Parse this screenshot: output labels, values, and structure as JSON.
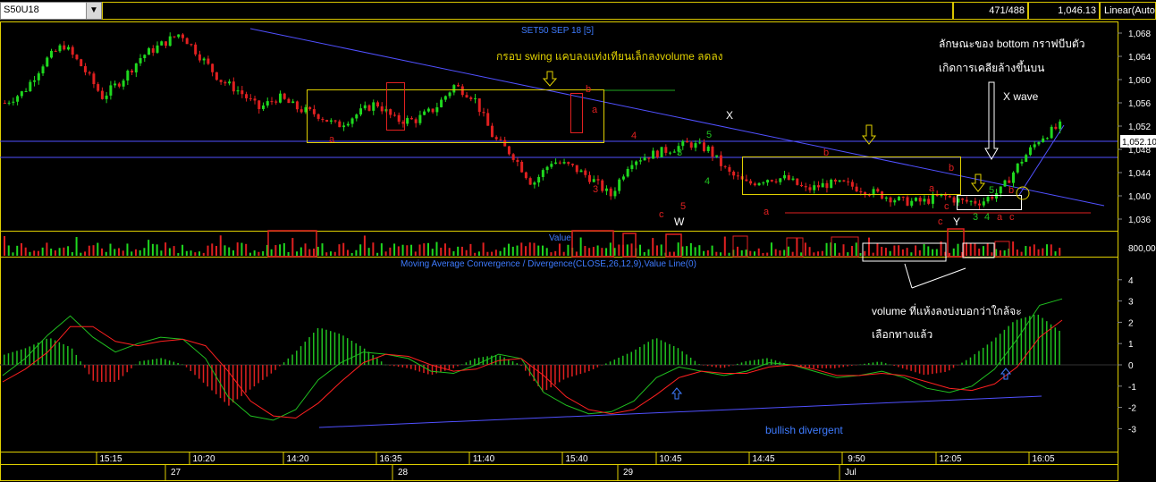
{
  "symbol": "S50U18",
  "bar_count": "471/488",
  "last_price": "1,046.13",
  "scale_mode": "Linear(Auto",
  "colors": {
    "up": "#1fd81f",
    "down": "#e02020",
    "frame": "#e0d000",
    "trend": "#5050ff",
    "signal": "#ff2020",
    "macd": "#20c020",
    "note": "#d8c800",
    "blue_label": "#3e7bff",
    "boxes": "#e0d000"
  },
  "price_panel": {
    "title": "SET50 SEP 18   [5]",
    "current_price_tag": "1,052.10",
    "y_ticks": [
      "1,068",
      "1,064",
      "1,060",
      "1,056",
      "1,052",
      "1,048",
      "1,044",
      "1,040",
      "1,036"
    ],
    "annotations": {
      "frame_note": "กรอบ swing แคบลงแท่งเทียนเล็กลงvolume ลดลง",
      "bottom_note_1": "ลักษณะของ bottom กราฟบีบตัว",
      "bottom_note_2": "เกิดการเคลียล้างขึ้นบน",
      "xwave": "X wave",
      "wave_x": "X",
      "wave_w": "W",
      "wave_y": "Y",
      "labels": [
        {
          "t": "a",
          "c": "red"
        },
        {
          "t": "b",
          "c": "red"
        },
        {
          "t": "a",
          "c": "red"
        },
        {
          "t": "4",
          "c": "red"
        },
        {
          "t": "3",
          "c": "red"
        },
        {
          "t": "5",
          "c": "red"
        },
        {
          "t": "c",
          "c": "red"
        },
        {
          "t": "3",
          "c": "green"
        },
        {
          "t": "4",
          "c": "green"
        },
        {
          "t": "5",
          "c": "green"
        },
        {
          "t": "b",
          "c": "red"
        },
        {
          "t": "a",
          "c": "red"
        },
        {
          "t": "a",
          "c": "red"
        },
        {
          "t": "b",
          "c": "red"
        },
        {
          "t": "c",
          "c": "red"
        },
        {
          "t": "c",
          "c": "red"
        },
        {
          "t": "5",
          "c": "green"
        },
        {
          "t": "b",
          "c": "red"
        },
        {
          "t": "3",
          "c": "green"
        },
        {
          "t": "4",
          "c": "green"
        },
        {
          "t": "a",
          "c": "red"
        },
        {
          "t": "c",
          "c": "red"
        }
      ]
    }
  },
  "volume_panel": {
    "title": "Value",
    "y_tick": "800,000"
  },
  "macd_panel": {
    "title": "Moving Average Convergence / Divergence(CLOSE,26,12,9),Value Line(0)",
    "y_ticks": [
      "4",
      "3",
      "2",
      "1",
      "0",
      "-1",
      "-2",
      "-3"
    ],
    "volume_note_1": "volume ที่แห้งลงบ่งบอกว่าใกล้จะ",
    "volume_note_2": "เลือกทางแล้ว",
    "divergence_note": "bullish divergent"
  },
  "time_axis": {
    "times": [
      "15:15",
      "10:20",
      "14:20",
      "16:35",
      "11:40",
      "15:40",
      "10:45",
      "14:45",
      "9:50",
      "12:05",
      "16:05"
    ],
    "dates": [
      "27",
      "28",
      "29",
      "Jul"
    ]
  },
  "chart_data": [
    {
      "type": "candlestick",
      "title": "SET50 SEP 18   [5]",
      "ylim": [
        1034,
        1070
      ],
      "ylabel": "",
      "y_ticks": [
        1068,
        1064,
        1060,
        1056,
        1052,
        1048,
        1044,
        1040,
        1036
      ],
      "x_time_labels": [
        "15:15",
        "10:20",
        "14:20",
        "16:35",
        "11:40",
        "15:40",
        "10:45",
        "14:45",
        "9:50",
        "12:05",
        "16:05"
      ],
      "close_path": [
        1056,
        1058,
        1063,
        1066,
        1062,
        1057,
        1060,
        1064,
        1066,
        1068,
        1064,
        1060,
        1058,
        1055,
        1057,
        1055,
        1054,
        1052,
        1054,
        1056,
        1053,
        1053,
        1055,
        1059,
        1057,
        1050,
        1047,
        1042,
        1046,
        1045,
        1043,
        1040,
        1046,
        1047,
        1048,
        1049,
        1048,
        1044,
        1042,
        1043,
        1043,
        1041,
        1042,
        1042,
        1041,
        1040,
        1039,
        1039,
        1040,
        1039,
        1039,
        1041,
        1046,
        1050,
        1052
      ],
      "last": 1052.1
    },
    {
      "type": "bar",
      "title": "Value",
      "y_ticks": [
        800000
      ]
    },
    {
      "type": "line",
      "title": "Moving Average Convergence / Divergence(CLOSE,26,12,9),Value Line(0)",
      "ylim": [
        -3.5,
        4.5
      ],
      "y_ticks": [
        4,
        3,
        2,
        1,
        0,
        -1,
        -2,
        -3
      ],
      "series_path": [
        -0.5,
        0.3,
        1.4,
        2.3,
        1.3,
        0.6,
        1.0,
        1.3,
        1.2,
        0.3,
        -1.5,
        -2.4,
        -2.6,
        -2.1,
        -0.7,
        0.1,
        0.6,
        0.5,
        0.3,
        -0.3,
        -0.4,
        0.0,
        0.5,
        0.3,
        -1.3,
        -1.9,
        -2.3,
        -2.2,
        -1.7,
        -0.6,
        -0.1,
        -0.3,
        -0.5,
        -0.3,
        0.1,
        0.0,
        -0.3,
        -0.6,
        -0.5,
        -0.3,
        -0.6,
        -1.1,
        -1.3,
        -1.0,
        -0.2,
        1.2,
        2.8,
        3.1
      ],
      "signal_path": [
        -0.8,
        -0.2,
        0.6,
        1.8,
        1.8,
        1.1,
        0.9,
        1.1,
        1.2,
        0.9,
        -0.3,
        -1.7,
        -2.4,
        -2.5,
        -1.8,
        -0.8,
        0.1,
        0.5,
        0.4,
        0.0,
        -0.3,
        -0.2,
        0.2,
        0.3,
        -0.5,
        -1.5,
        -2.1,
        -2.3,
        -2.1,
        -1.4,
        -0.6,
        -0.3,
        -0.4,
        -0.4,
        -0.1,
        0.0,
        -0.2,
        -0.5,
        -0.5,
        -0.4,
        -0.5,
        -0.8,
        -1.1,
        -1.2,
        -0.9,
        -0.1,
        1.3,
        2.1
      ]
    }
  ]
}
